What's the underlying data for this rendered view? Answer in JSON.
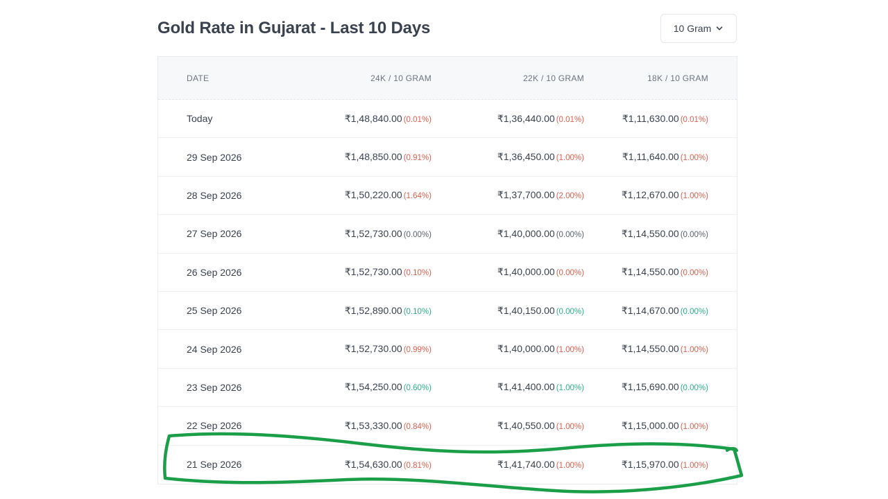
{
  "title": "Gold Rate in Gujarat - Last 10 Days",
  "unit_select": {
    "value": "10 Gram"
  },
  "headers": {
    "date": "DATE",
    "k24": "24K / 10 GRAM",
    "k22": "22K / 10 GRAM",
    "k18": "18K / 10 GRAM"
  },
  "colors": {
    "negative": "#e0604f",
    "positive": "#2bb38a",
    "annotation": "#1a9e47"
  },
  "rows": [
    {
      "date": "Today",
      "k24": {
        "price": "₹1,48,840.00",
        "change": "(0.01%)",
        "trend": "neg"
      },
      "k22": {
        "price": "₹1,36,440.00",
        "change": "(0.01%)",
        "trend": "neg"
      },
      "k18": {
        "price": "₹1,11,630.00",
        "change": "(0.01%)",
        "trend": "neg"
      }
    },
    {
      "date": "29 Sep 2026",
      "k24": {
        "price": "₹1,48,850.00",
        "change": "(0.91%)",
        "trend": "neg"
      },
      "k22": {
        "price": "₹1,36,450.00",
        "change": "(1.00%)",
        "trend": "neg"
      },
      "k18": {
        "price": "₹1,11,640.00",
        "change": "(1.00%)",
        "trend": "neg"
      }
    },
    {
      "date": "28 Sep 2026",
      "k24": {
        "price": "₹1,50,220.00",
        "change": "(1.64%)",
        "trend": "neg"
      },
      "k22": {
        "price": "₹1,37,700.00",
        "change": "(2.00%)",
        "trend": "neg"
      },
      "k18": {
        "price": "₹1,12,670.00",
        "change": "(1.00%)",
        "trend": "neg"
      }
    },
    {
      "date": "27 Sep 2026",
      "k24": {
        "price": "₹1,52,730.00",
        "change": "(0.00%)",
        "trend": "zero"
      },
      "k22": {
        "price": "₹1,40,000.00",
        "change": "(0.00%)",
        "trend": "zero"
      },
      "k18": {
        "price": "₹1,14,550.00",
        "change": "(0.00%)",
        "trend": "zero"
      }
    },
    {
      "date": "26 Sep 2026",
      "k24": {
        "price": "₹1,52,730.00",
        "change": "(0.10%)",
        "trend": "neg"
      },
      "k22": {
        "price": "₹1,40,000.00",
        "change": "(0.00%)",
        "trend": "neg"
      },
      "k18": {
        "price": "₹1,14,550.00",
        "change": "(0.00%)",
        "trend": "neg"
      }
    },
    {
      "date": "25 Sep 2026",
      "k24": {
        "price": "₹1,52,890.00",
        "change": "(0.10%)",
        "trend": "pos"
      },
      "k22": {
        "price": "₹1,40,150.00",
        "change": "(0.00%)",
        "trend": "pos"
      },
      "k18": {
        "price": "₹1,14,670.00",
        "change": "(0.00%)",
        "trend": "pos"
      }
    },
    {
      "date": "24 Sep 2026",
      "k24": {
        "price": "₹1,52,730.00",
        "change": "(0.99%)",
        "trend": "neg"
      },
      "k22": {
        "price": "₹1,40,000.00",
        "change": "(1.00%)",
        "trend": "neg"
      },
      "k18": {
        "price": "₹1,14,550.00",
        "change": "(1.00%)",
        "trend": "neg"
      }
    },
    {
      "date": "23 Sep 2026",
      "k24": {
        "price": "₹1,54,250.00",
        "change": "(0.60%)",
        "trend": "pos"
      },
      "k22": {
        "price": "₹1,41,400.00",
        "change": "(1.00%)",
        "trend": "pos"
      },
      "k18": {
        "price": "₹1,15,690.00",
        "change": "(0.00%)",
        "trend": "pos"
      }
    },
    {
      "date": "22 Sep 2026",
      "k24": {
        "price": "₹1,53,330.00",
        "change": "(0.84%)",
        "trend": "neg"
      },
      "k22": {
        "price": "₹1,40,550.00",
        "change": "(1.00%)",
        "trend": "neg"
      },
      "k18": {
        "price": "₹1,15,000.00",
        "change": "(1.00%)",
        "trend": "neg"
      }
    },
    {
      "date": "21 Sep 2026",
      "k24": {
        "price": "₹1,54,630.00",
        "change": "(0.81%)",
        "trend": "neg"
      },
      "k22": {
        "price": "₹1,41,740.00",
        "change": "(1.00%)",
        "trend": "neg"
      },
      "k18": {
        "price": "₹1,15,970.00",
        "change": "(1.00%)",
        "trend": "neg"
      }
    }
  ]
}
